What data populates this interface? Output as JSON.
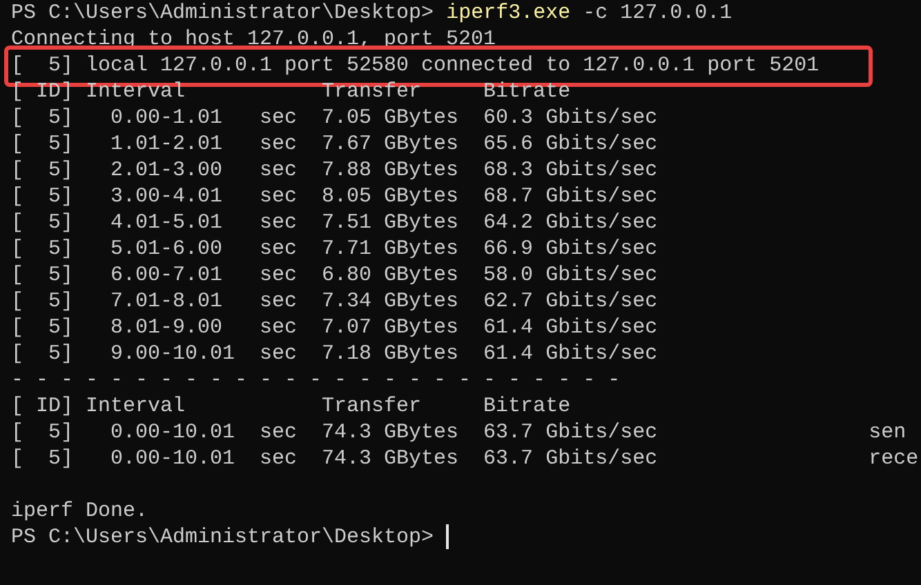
{
  "terminal": {
    "lines": [
      {
        "kind": "prompt",
        "prompt": "PS C:\\Users\\Administrator\\Desktop>",
        "command": "iperf3.exe",
        "args": "-c 127.0.0.1"
      },
      {
        "kind": "output",
        "text": "Connecting to host 127.0.0.1, port 5201",
        "highlighted": false
      },
      {
        "kind": "output",
        "text": "[  5] local 127.0.0.1 port 52580 connected to 127.0.0.1 port 5201",
        "highlighted": true
      },
      {
        "kind": "output",
        "text": "[ ID] Interval           Transfer     Bitrate",
        "highlighted": false
      },
      {
        "kind": "output",
        "text": "[  5]   0.00-1.01   sec  7.05 GBytes  60.3 Gbits/sec",
        "highlighted": false
      },
      {
        "kind": "output",
        "text": "[  5]   1.01-2.01   sec  7.67 GBytes  65.6 Gbits/sec",
        "highlighted": false
      },
      {
        "kind": "output",
        "text": "[  5]   2.01-3.00   sec  7.88 GBytes  68.3 Gbits/sec",
        "highlighted": false
      },
      {
        "kind": "output",
        "text": "[  5]   3.00-4.01   sec  8.05 GBytes  68.7 Gbits/sec",
        "highlighted": false
      },
      {
        "kind": "output",
        "text": "[  5]   4.01-5.01   sec  7.51 GBytes  64.2 Gbits/sec",
        "highlighted": false
      },
      {
        "kind": "output",
        "text": "[  5]   5.01-6.00   sec  7.71 GBytes  66.9 Gbits/sec",
        "highlighted": false
      },
      {
        "kind": "output",
        "text": "[  5]   6.00-7.01   sec  6.80 GBytes  58.0 Gbits/sec",
        "highlighted": false
      },
      {
        "kind": "output",
        "text": "[  5]   7.01-8.01   sec  7.34 GBytes  62.7 Gbits/sec",
        "highlighted": false
      },
      {
        "kind": "output",
        "text": "[  5]   8.01-9.00   sec  7.07 GBytes  61.4 Gbits/sec",
        "highlighted": false
      },
      {
        "kind": "output",
        "text": "[  5]   9.00-10.01  sec  7.18 GBytes  61.4 Gbits/sec",
        "highlighted": false
      },
      {
        "kind": "output",
        "text": "- - - - - - - - - - - - - - - - - - - - - - - - -",
        "highlighted": false
      },
      {
        "kind": "output",
        "text": "[ ID] Interval           Transfer     Bitrate",
        "highlighted": false
      },
      {
        "kind": "output",
        "text": "[  5]   0.00-10.01  sec  74.3 GBytes  63.7 Gbits/sec                 sen",
        "highlighted": false
      },
      {
        "kind": "output",
        "text": "[  5]   0.00-10.01  sec  74.3 GBytes  63.7 Gbits/sec                 rece",
        "highlighted": false
      },
      {
        "kind": "blank"
      },
      {
        "kind": "output",
        "text": "iperf Done.",
        "highlighted": false
      },
      {
        "kind": "prompt",
        "prompt": "PS C:\\Users\\Administrator\\Desktop>",
        "cursor": true
      }
    ]
  }
}
